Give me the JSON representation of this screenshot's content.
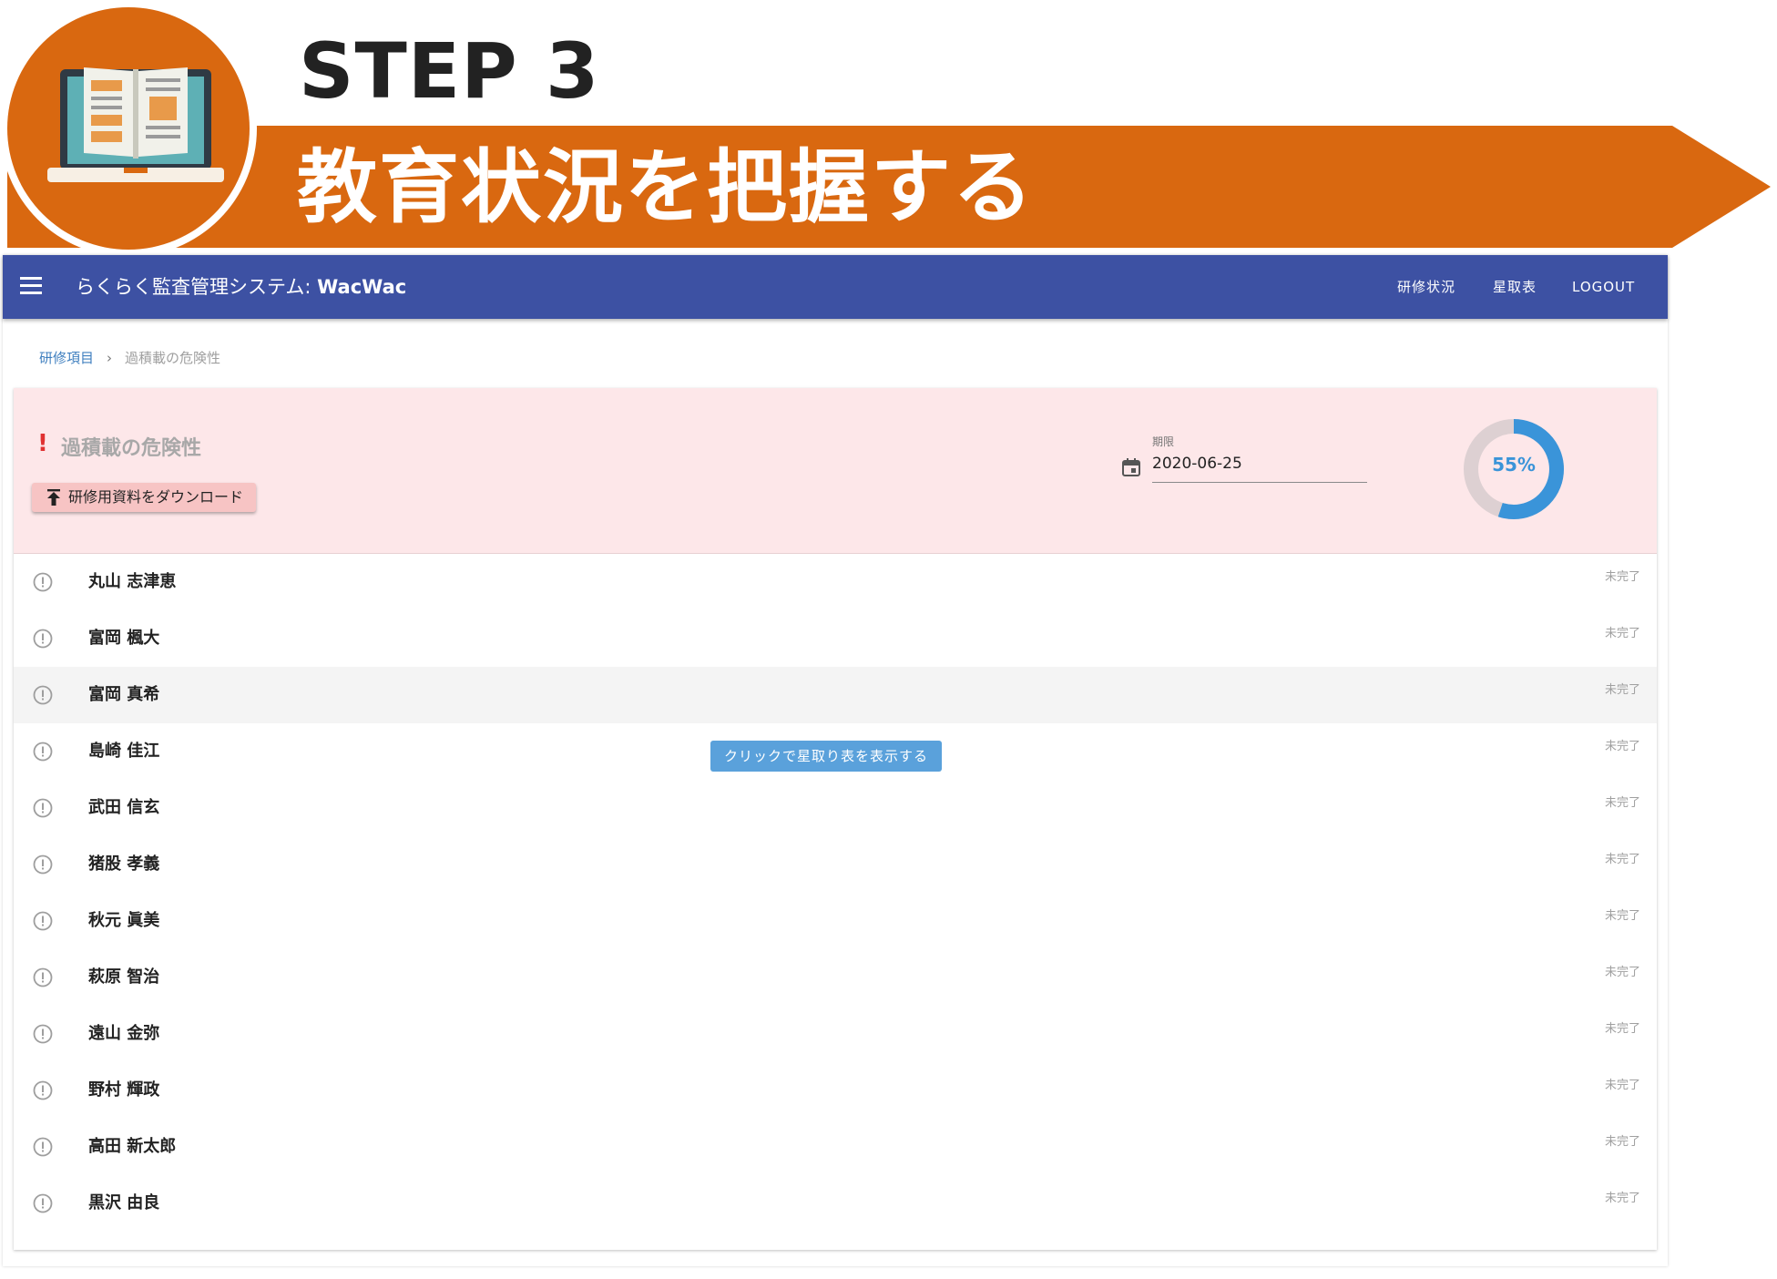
{
  "step": {
    "title": "STEP 3",
    "subtitle": "教育状況を把握する",
    "badge_icon": "laptop-book-icon",
    "accent_color": "#d96810"
  },
  "appbar": {
    "menu_icon": "hamburger-menu-icon",
    "title_prefix": "らくらく監査管理システム: ",
    "title_brand": "WacWac",
    "nav": [
      "研修状況",
      "星取表",
      "LOGOUT"
    ],
    "color": "#3d51a3"
  },
  "breadcrumb": {
    "link": "研修項目",
    "separator": "›",
    "current": "過積載の危険性"
  },
  "topic": {
    "alert_mark": "!",
    "title": "過積載の危険性",
    "download_label": "研修用資料をダウンロード",
    "download_icon": "upload-arrow-icon"
  },
  "deadline": {
    "label": "期限",
    "value": "2020-06-25",
    "icon": "calendar-icon"
  },
  "progress": {
    "percent": 55,
    "label": "55%",
    "color": "#3a94d9"
  },
  "tooltip": "クリックで星取り表を表示する",
  "members": [
    {
      "name": "丸山 志津恵",
      "status": "未完了"
    },
    {
      "name": "富岡 楓大",
      "status": "未完了"
    },
    {
      "name": "富岡 真希",
      "status": "未完了"
    },
    {
      "name": "島崎 佳江",
      "status": "未完了"
    },
    {
      "name": "武田 信玄",
      "status": "未完了"
    },
    {
      "name": "猪股 孝義",
      "status": "未完了"
    },
    {
      "name": "秋元 眞美",
      "status": "未完了"
    },
    {
      "name": "萩原 智治",
      "status": "未完了"
    },
    {
      "name": "遠山 金弥",
      "status": "未完了"
    },
    {
      "name": "野村 輝政",
      "status": "未完了"
    },
    {
      "name": "高田 新太郎",
      "status": "未完了"
    },
    {
      "name": "黒沢 由良",
      "status": "未完了"
    }
  ]
}
